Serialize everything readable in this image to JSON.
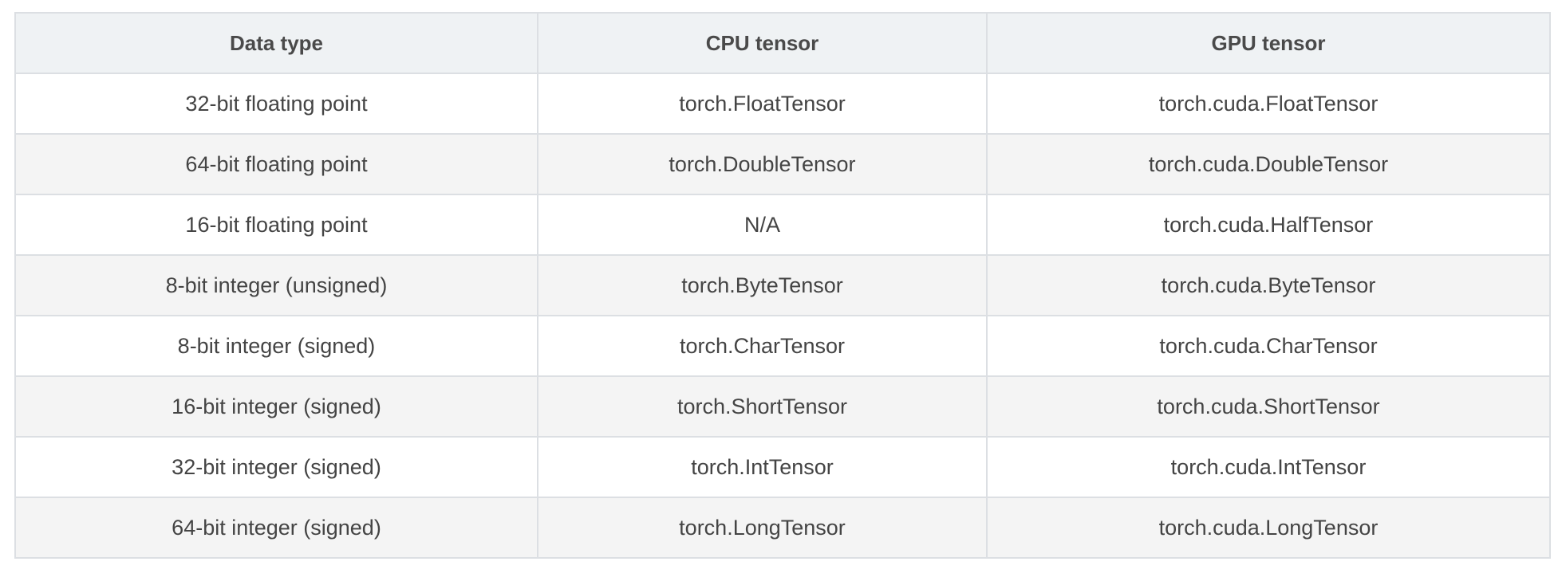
{
  "table": {
    "headers": [
      "Data type",
      "CPU tensor",
      "GPU tensor"
    ],
    "rows": [
      [
        "32-bit floating point",
        "torch.FloatTensor",
        "torch.cuda.FloatTensor"
      ],
      [
        "64-bit floating point",
        "torch.DoubleTensor",
        "torch.cuda.DoubleTensor"
      ],
      [
        "16-bit floating point",
        "N/A",
        "torch.cuda.HalfTensor"
      ],
      [
        "8-bit integer (unsigned)",
        "torch.ByteTensor",
        "torch.cuda.ByteTensor"
      ],
      [
        "8-bit integer (signed)",
        "torch.CharTensor",
        "torch.cuda.CharTensor"
      ],
      [
        "16-bit integer (signed)",
        "torch.ShortTensor",
        "torch.cuda.ShortTensor"
      ],
      [
        "32-bit integer (signed)",
        "torch.IntTensor",
        "torch.cuda.IntTensor"
      ],
      [
        "64-bit integer (signed)",
        "torch.LongTensor",
        "torch.cuda.LongTensor"
      ]
    ]
  },
  "colors": {
    "header_bg": "#eff2f4",
    "row_alt_bg": "#f4f4f4",
    "border": "#dcdfe3",
    "text": "#444444"
  }
}
